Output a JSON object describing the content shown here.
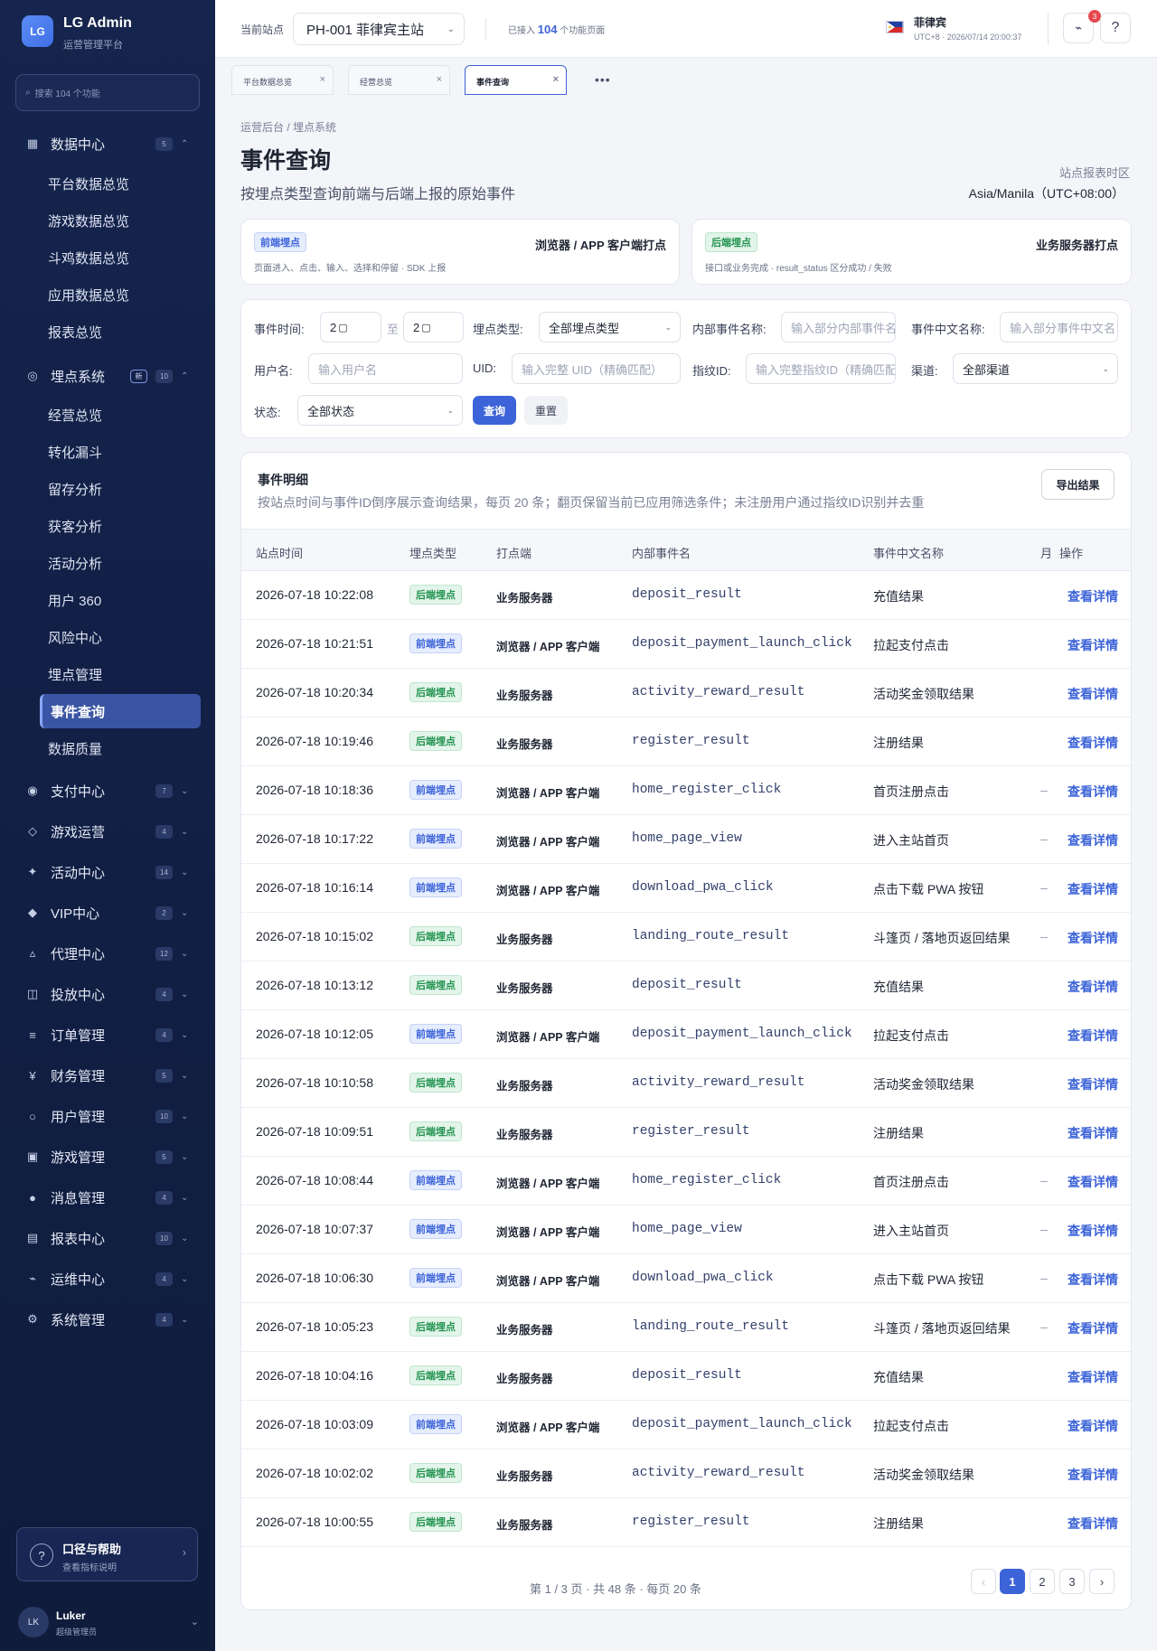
{
  "brand": {
    "logo": "LG",
    "title": "LG Admin",
    "subtitle": "运营管理平台"
  },
  "sidebar": {
    "search_placeholder": "搜索 104 个功能",
    "groups": [
      {
        "icon": "grid-icon",
        "glyph": "▦",
        "label": "数据中心",
        "badge": "5",
        "expanded": true
      },
      {
        "icon": "target-icon",
        "glyph": "◎",
        "label": "埋点系统",
        "new": "新",
        "badge": "10",
        "expanded": true
      },
      {
        "icon": "payment-icon",
        "glyph": "◉",
        "label": "支付中心",
        "badge": "7"
      },
      {
        "icon": "diamond-outline-icon",
        "glyph": "◇",
        "label": "游戏运营",
        "badge": "4"
      },
      {
        "icon": "sparkle-icon",
        "glyph": "✦",
        "label": "活动中心",
        "badge": "14"
      },
      {
        "icon": "diamond-icon",
        "glyph": "◆",
        "label": "VIP中心",
        "badge": "2"
      },
      {
        "icon": "triangle-icon",
        "glyph": "▵",
        "label": "代理中心",
        "badge": "12"
      },
      {
        "icon": "book-icon",
        "glyph": "◫",
        "label": "投放中心",
        "badge": "4"
      },
      {
        "icon": "list-icon",
        "glyph": "≡",
        "label": "订单管理",
        "badge": "4"
      },
      {
        "icon": "yen-icon",
        "glyph": "¥",
        "label": "财务管理",
        "badge": "5"
      },
      {
        "icon": "user-circle-icon",
        "glyph": "○",
        "label": "用户管理",
        "badge": "10"
      },
      {
        "icon": "gamepad-icon",
        "glyph": "▣",
        "label": "游戏管理",
        "badge": "5"
      },
      {
        "icon": "message-icon",
        "glyph": "●",
        "label": "消息管理",
        "badge": "4"
      },
      {
        "icon": "report-icon",
        "glyph": "▤",
        "label": "报表中心",
        "badge": "10"
      },
      {
        "icon": "ops-icon",
        "glyph": "⌁",
        "label": "运维中心",
        "badge": "4"
      },
      {
        "icon": "gear-icon",
        "glyph": "⚙",
        "label": "系统管理",
        "badge": "4"
      }
    ],
    "data_center_items": [
      "平台数据总览",
      "游戏数据总览",
      "斗鸡数据总览",
      "应用数据总览",
      "报表总览"
    ],
    "tracking_items": [
      "经营总览",
      "转化漏斗",
      "留存分析",
      "获客分析",
      "活动分析",
      "用户 360",
      "风险中心",
      "埋点管理",
      "事件查询",
      "数据质量"
    ],
    "help": {
      "title": "口径与帮助",
      "subtitle": "查看指标说明"
    },
    "user": {
      "initials": "LK",
      "name": "Luker",
      "role": "超级管理员"
    }
  },
  "header": {
    "site_label": "当前站点",
    "site_value": "PH-001 菲律宾主站",
    "connected_prefix": "已接入",
    "connected_count": "104",
    "connected_suffix": "个功能页面",
    "country": "菲律宾",
    "tz": "UTC+8 · 2026/07/14 20:00:37",
    "notif_count": "3",
    "help_glyph": "?"
  },
  "tabs": [
    {
      "label": "平台数据总览"
    },
    {
      "label": "经营总览"
    },
    {
      "label": "事件查询",
      "active": true
    }
  ],
  "page": {
    "breadcrumb": "运营后台 / 埋点系统",
    "title": "事件查询",
    "description": "按埋点类型查询前端与后端上报的原始事件",
    "tz_label": "站点报表时区",
    "tz_value": "Asia/Manila（UTC+08:00）"
  },
  "type_cards": [
    {
      "tag": "前端埋点",
      "title": "浏览器 / APP 客户端打点",
      "desc": "页面进入、点击、输入、选择和停留 · SDK 上报"
    },
    {
      "tag": "后端埋点",
      "title": "业务服务器打点",
      "desc": "接口或业务完成 · result_status 区分成功 / 失败"
    }
  ],
  "filters": {
    "time_label": "事件时间:",
    "time_from": "2",
    "time_sep": "至",
    "time_to": "2",
    "type_label": "埋点类型:",
    "type_value": "全部埋点类型",
    "inner_label": "内部事件名称:",
    "inner_ph": "输入部分内部事件名",
    "cn_label": "事件中文名称:",
    "cn_ph": "输入部分事件中文名",
    "user_label": "用户名:",
    "user_ph": "输入用户名",
    "uid_label": "UID:",
    "uid_ph": "输入完整 UID（精确匹配）",
    "fp_label": "指纹ID:",
    "fp_ph": "输入完整指纹ID（精确匹配）",
    "channel_label": "渠道:",
    "channel_value": "全部渠道",
    "status_label": "状态:",
    "status_value": "全部状态",
    "query": "查询",
    "reset": "重置"
  },
  "table": {
    "title": "事件明细",
    "desc": "按站点时间与事件ID倒序展示查询结果，每页 20 条；翻页保留当前已应用筛选条件；未注册用户通过指纹ID识别并去重",
    "export": "导出结果",
    "headers": [
      "站点时间",
      "埋点类型",
      "打点端",
      "内部事件名",
      "事件中文名称",
      "月",
      "操作"
    ],
    "rows": [
      {
        "time": "2026-07-18 10:22:08",
        "type": "后端埋点",
        "src": "业务服务器",
        "event": "deposit_result",
        "cn": "充值结果",
        "extra": "",
        "op": "查看详情"
      },
      {
        "time": "2026-07-18 10:21:51",
        "type": "前端埋点",
        "src": "浏览器 / APP 客户端",
        "event": "deposit_payment_launch_click",
        "cn": "拉起支付点击",
        "extra": "",
        "op": "查看详情"
      },
      {
        "time": "2026-07-18 10:20:34",
        "type": "后端埋点",
        "src": "业务服务器",
        "event": "activity_reward_result",
        "cn": "活动奖金领取结果",
        "extra": "",
        "op": "查看详情"
      },
      {
        "time": "2026-07-18 10:19:46",
        "type": "后端埋点",
        "src": "业务服务器",
        "event": "register_result",
        "cn": "注册结果",
        "extra": "",
        "op": "查看详情"
      },
      {
        "time": "2026-07-18 10:18:36",
        "type": "前端埋点",
        "src": "浏览器 / APP 客户端",
        "event": "home_register_click",
        "cn": "首页注册点击",
        "extra": "–",
        "op": "查看详情"
      },
      {
        "time": "2026-07-18 10:17:22",
        "type": "前端埋点",
        "src": "浏览器 / APP 客户端",
        "event": "home_page_view",
        "cn": "进入主站首页",
        "extra": "–",
        "op": "查看详情"
      },
      {
        "time": "2026-07-18 10:16:14",
        "type": "前端埋点",
        "src": "浏览器 / APP 客户端",
        "event": "download_pwa_click",
        "cn": "点击下载 PWA 按钮",
        "extra": "–",
        "op": "查看详情"
      },
      {
        "time": "2026-07-18 10:15:02",
        "type": "后端埋点",
        "src": "业务服务器",
        "event": "landing_route_result",
        "cn": "斗篷页 / 落地页返回结果",
        "extra": "–",
        "op": "查看详情"
      },
      {
        "time": "2026-07-18 10:13:12",
        "type": "后端埋点",
        "src": "业务服务器",
        "event": "deposit_result",
        "cn": "充值结果",
        "extra": "",
        "op": "查看详情"
      },
      {
        "time": "2026-07-18 10:12:05",
        "type": "前端埋点",
        "src": "浏览器 / APP 客户端",
        "event": "deposit_payment_launch_click",
        "cn": "拉起支付点击",
        "extra": "",
        "op": "查看详情"
      },
      {
        "time": "2026-07-18 10:10:58",
        "type": "后端埋点",
        "src": "业务服务器",
        "event": "activity_reward_result",
        "cn": "活动奖金领取结果",
        "extra": "",
        "op": "查看详情"
      },
      {
        "time": "2026-07-18 10:09:51",
        "type": "后端埋点",
        "src": "业务服务器",
        "event": "register_result",
        "cn": "注册结果",
        "extra": "",
        "op": "查看详情"
      },
      {
        "time": "2026-07-18 10:08:44",
        "type": "前端埋点",
        "src": "浏览器 / APP 客户端",
        "event": "home_register_click",
        "cn": "首页注册点击",
        "extra": "–",
        "op": "查看详情"
      },
      {
        "time": "2026-07-18 10:07:37",
        "type": "前端埋点",
        "src": "浏览器 / APP 客户端",
        "event": "home_page_view",
        "cn": "进入主站首页",
        "extra": "–",
        "op": "查看详情"
      },
      {
        "time": "2026-07-18 10:06:30",
        "type": "前端埋点",
        "src": "浏览器 / APP 客户端",
        "event": "download_pwa_click",
        "cn": "点击下载 PWA 按钮",
        "extra": "–",
        "op": "查看详情"
      },
      {
        "time": "2026-07-18 10:05:23",
        "type": "后端埋点",
        "src": "业务服务器",
        "event": "landing_route_result",
        "cn": "斗篷页 / 落地页返回结果",
        "extra": "–",
        "op": "查看详情"
      },
      {
        "time": "2026-07-18 10:04:16",
        "type": "后端埋点",
        "src": "业务服务器",
        "event": "deposit_result",
        "cn": "充值结果",
        "extra": "",
        "op": "查看详情"
      },
      {
        "time": "2026-07-18 10:03:09",
        "type": "前端埋点",
        "src": "浏览器 / APP 客户端",
        "event": "deposit_payment_launch_click",
        "cn": "拉起支付点击",
        "extra": "",
        "op": "查看详情"
      },
      {
        "time": "2026-07-18 10:02:02",
        "type": "后端埋点",
        "src": "业务服务器",
        "event": "activity_reward_result",
        "cn": "活动奖金领取结果",
        "extra": "",
        "op": "查看详情"
      },
      {
        "time": "2026-07-18 10:00:55",
        "type": "后端埋点",
        "src": "业务服务器",
        "event": "register_result",
        "cn": "注册结果",
        "extra": "",
        "op": "查看详情"
      }
    ]
  },
  "pager": {
    "info": "第 1 / 3 页 · 共 48 条 · 每页 20 条",
    "prev": "‹",
    "pages": [
      "1",
      "2",
      "3"
    ],
    "next": "›"
  }
}
